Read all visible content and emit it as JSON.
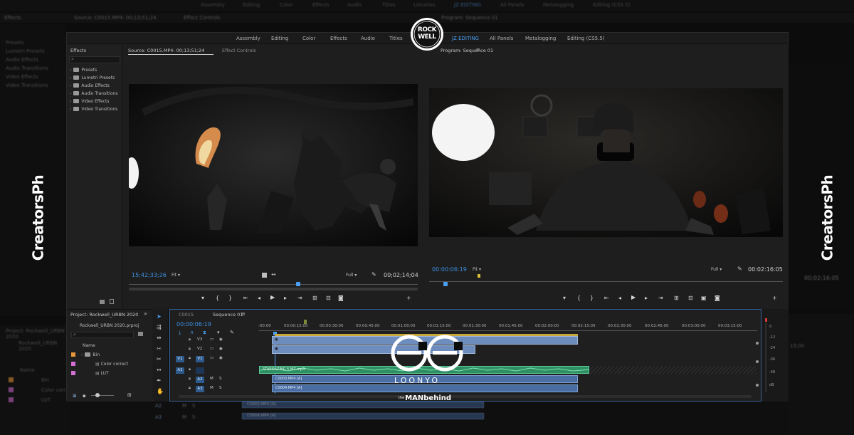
{
  "workspaces": [
    "Assembly",
    "Editing",
    "Color",
    "Effects",
    "Audio",
    "Titles",
    "Libraries",
    "JZ EDITING",
    "All Panels",
    "Metalogging",
    "Editing (CS5.5)"
  ],
  "background": {
    "effects_title": "Effects",
    "effects_items": [
      "Presets",
      "Lumetri Presets",
      "Audio Effects",
      "Audio Transitions",
      "Video Effects",
      "Video Transitions"
    ],
    "source_tab": "Source: C0015.MP4: 00;13;51;24",
    "effect_controls_tab": "Effect Controls",
    "program_tab": "Program: Sequence 01",
    "project_title": "Project: Rockwell_URBN 2020",
    "project_file": "Rockwell_URBN 2020",
    "project_name_col": "Name",
    "project_items": [
      "Bin",
      "Color corr",
      "LUT"
    ],
    "program_duration": "00;02;16;05",
    "timeline_time": "15;00",
    "clip_labels": [
      "C0003.MP4 [A]",
      "C0004.MP4 [A]"
    ],
    "track_a1": "A1",
    "track_a2": "A2",
    "track_a3": "A3",
    "m": "M",
    "s": "S"
  },
  "effects": {
    "title": "Effects",
    "items": [
      "Presets",
      "Lumetri Presets",
      "Audio Effects",
      "Audio Transitions",
      "Video Effects",
      "Video Transitions"
    ]
  },
  "source": {
    "tab": "Source: C0015.MP4: 00;13;51;24",
    "effect_controls": "Effect Controls",
    "timecode": "15;42;33;26",
    "fit": "Fit",
    "quality": "Full",
    "duration": "00;02;14;04"
  },
  "program": {
    "tab": "Program: Sequence 01",
    "timecode": "00:00:06:19",
    "fit": "Fit",
    "quality": "Full",
    "duration": "00:02:16:05"
  },
  "project": {
    "title": "Project: Rockwell_URBN 2020",
    "file": "Rockwell_URBN 2020.prproj",
    "name_col": "Name",
    "items": [
      {
        "name": "Bin",
        "color": "#e8963a"
      },
      {
        "name": "Color correct",
        "color": "#d36fd3"
      },
      {
        "name": "LUT",
        "color": "#d36fd3"
      }
    ]
  },
  "timeline": {
    "tab_clip": "C0015",
    "tab_seq": "Sequence 01",
    "timecode": "00:00:06:19",
    "ruler": [
      ":00:00",
      "00:00:15:00",
      "00:00:30:00",
      "00:00:45:00",
      "00:01:00:00",
      "00:01:15:00",
      "00:01:30:00",
      "00:01:45:00",
      "00:02:00:00",
      "00:02:15:00",
      "00:02:30:00",
      "00:02:45:00",
      "00:03:00:00",
      "00:03:15:00"
    ],
    "tracks": {
      "v3": "V3",
      "v2": "V2",
      "v1": "V1",
      "a1": "A1",
      "a2": "A2",
      "a3": "A3",
      "m": "M",
      "s": "S"
    },
    "audio_clip_1": "STARGAZING 5 MZ.mp3",
    "audio_clip_2": "C0003.MP4 [A]",
    "audio_clip_3": "C0004.MP4 [A]"
  },
  "meters": [
    "0",
    "-12",
    "-24",
    "-36",
    "-48",
    "dB"
  ],
  "overlays": {
    "rockwell_top": "ROCK",
    "rockwell_bottom": "WELL",
    "creators_left": "CreatorsPh",
    "creators_right": "CreatorsPh",
    "loonyo": "LOONYO",
    "manbehind_prefix": "the",
    "manbehind": "MANbehind"
  }
}
